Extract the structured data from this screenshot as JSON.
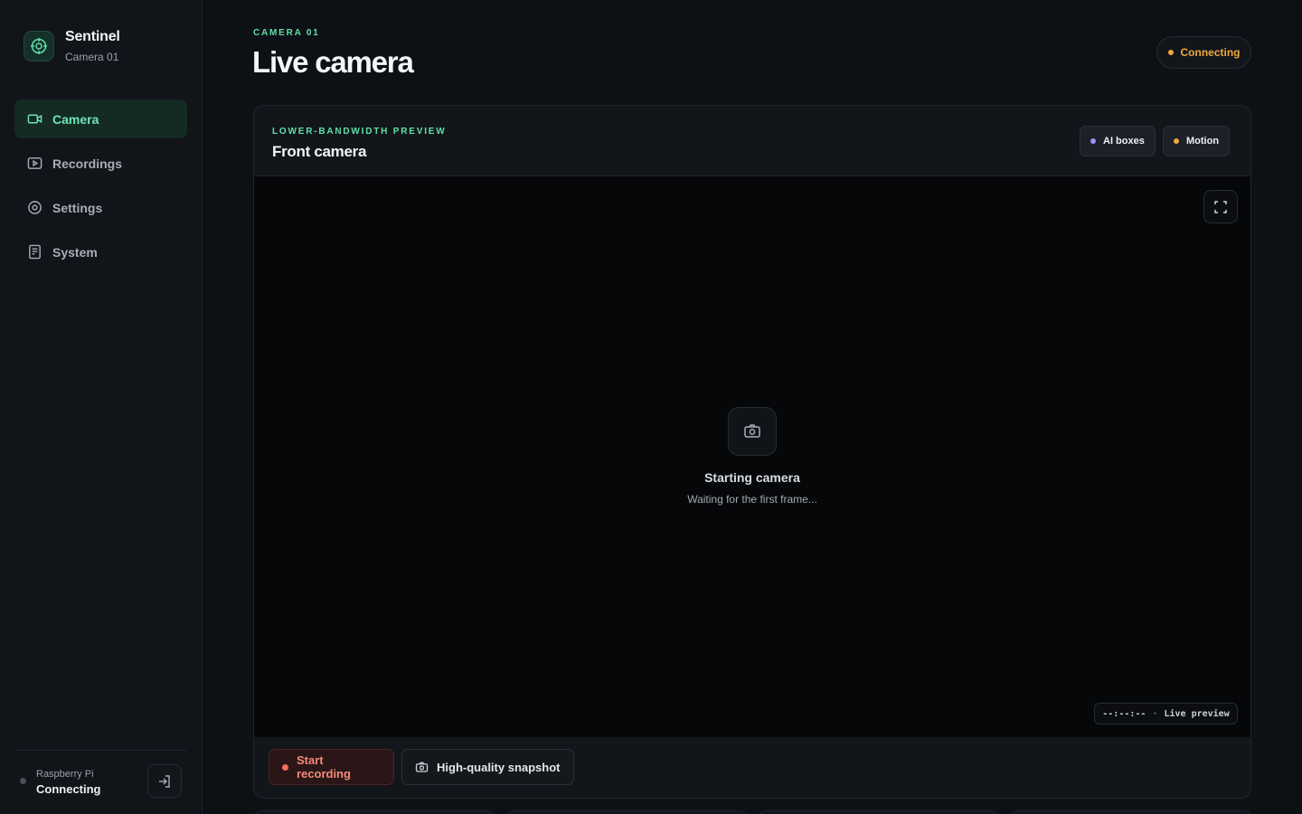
{
  "brand": {
    "name": "Sentinel",
    "subtitle": "Camera 01"
  },
  "nav": {
    "items": [
      {
        "label": "Camera",
        "icon": "video-icon",
        "active": true
      },
      {
        "label": "Recordings",
        "icon": "play-square-icon",
        "active": false
      },
      {
        "label": "Settings",
        "icon": "gear-icon",
        "active": false
      },
      {
        "label": "System",
        "icon": "document-icon",
        "active": false
      }
    ]
  },
  "device": {
    "label": "Raspberry Pi",
    "status": "Connecting"
  },
  "header": {
    "eyebrow": "CAMERA 01",
    "title": "Live camera",
    "status": "Connecting"
  },
  "card": {
    "eyebrow": "LOWER-BANDWIDTH PREVIEW",
    "title": "Front camera",
    "toggles": [
      {
        "label": "AI boxes",
        "color": "#a78bfa"
      },
      {
        "label": "Motion",
        "color": "#f0a93c"
      }
    ]
  },
  "video": {
    "title": "Starting camera",
    "subtitle": "Waiting for the first frame...",
    "timestamp": "--:--:--",
    "mode": "Live preview"
  },
  "actions": {
    "record_label": "Start recording",
    "snapshot_label": "High-quality snapshot"
  },
  "colors": {
    "accent": "#5fe0a8",
    "warning": "#f0a93c",
    "danger": "#f46e5e"
  }
}
